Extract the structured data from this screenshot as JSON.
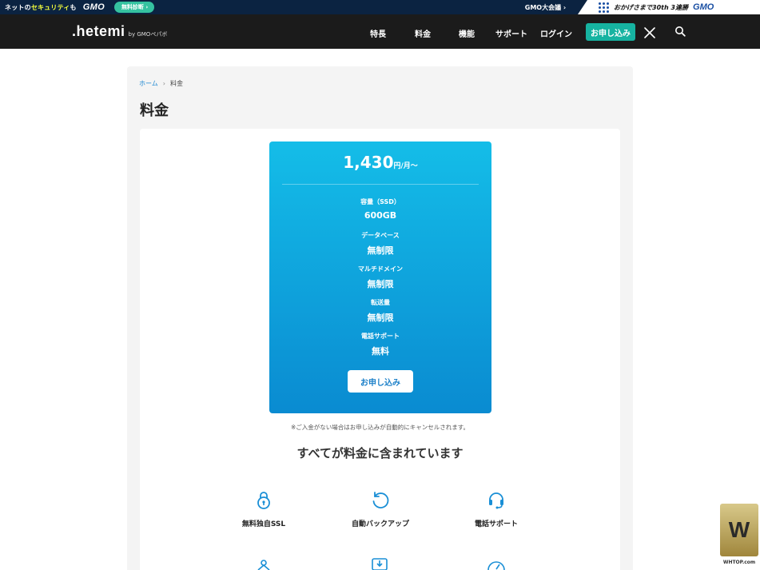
{
  "gmo_bar": {
    "security_prefix": "ネットの",
    "security_highlight": "セキュリティ",
    "security_suffix": "も",
    "gmo_logo": "GMO",
    "diag_badge": "無料診断 ›",
    "conference": "GMO大会議 ›",
    "thanks": "おかげさまで30th 3連勝",
    "gmo_logo_right": "GMO"
  },
  "header": {
    "brand": ".hetemi",
    "brand_by": "by GMOペパボ",
    "nav": [
      "特長",
      "料金",
      "機能",
      "サポート",
      "ログイン"
    ],
    "apply": "お申し込み",
    "colors": {
      "bg": "#1b1b1b",
      "apply_bg": "#16b3a1"
    }
  },
  "breadcrumb": {
    "home": "ホーム",
    "separator": "›",
    "current": "料金"
  },
  "page_title": "料金",
  "plan": {
    "price": "1,430",
    "price_unit": "円/月〜",
    "specs": [
      {
        "label": "容量（SSD）",
        "value": "600GB"
      },
      {
        "label": "データベース",
        "value": "無制限"
      },
      {
        "label": "マルチドメイン",
        "value": "無制限"
      },
      {
        "label": "転送量",
        "value": "無制限"
      },
      {
        "label": "電話サポート",
        "value": "無料"
      }
    ],
    "button": "お申し込み",
    "gradient": [
      "#14bde8",
      "#0a8bd1"
    ]
  },
  "note": "※ご入金がない場合はお申し込みが自動的にキャンセルされます。",
  "included_heading": "すべてが料金に含まれています",
  "features": [
    {
      "icon": "lock-icon",
      "label": "無料独自SSL"
    },
    {
      "icon": "backup-icon",
      "label": "自動バックアップ"
    },
    {
      "icon": "headset-icon",
      "label": "電話サポート"
    }
  ],
  "watermark": "WHTOP.com"
}
